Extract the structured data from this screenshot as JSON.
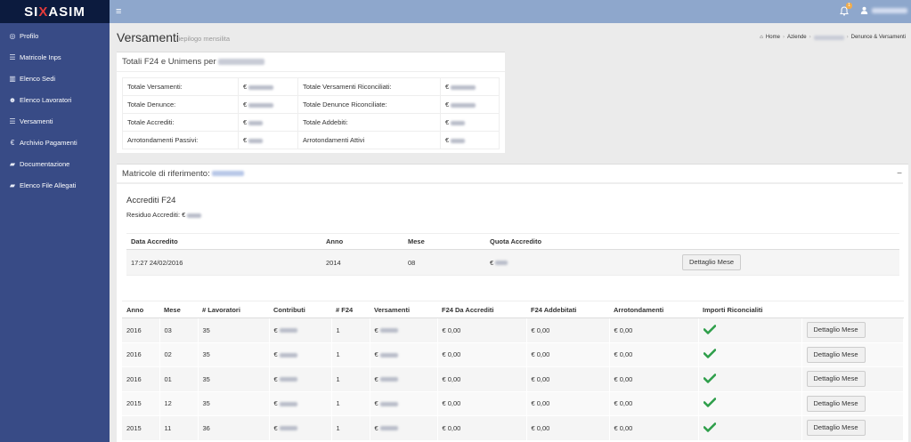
{
  "brand": {
    "logo_text_a": "SI",
    "logo_text_b": "X",
    "logo_text_c": "ASIM"
  },
  "sidebar": {
    "items": [
      {
        "label": "Profilo",
        "icon": "dashboard-icon"
      },
      {
        "label": "Matricole Inps",
        "icon": "list-icon"
      },
      {
        "label": "Elenco Sedi",
        "icon": "bank-icon"
      },
      {
        "label": "Elenco Lavoratori",
        "icon": "users-icon"
      },
      {
        "label": "Versamenti",
        "icon": "list-icon"
      },
      {
        "label": "Archivio Pagamenti",
        "icon": "euro-icon"
      },
      {
        "label": "Documentazione",
        "icon": "folder-icon"
      },
      {
        "label": "Elenco File Allegati",
        "icon": "folder-icon"
      }
    ]
  },
  "topbar": {
    "notifications_count": "1"
  },
  "header": {
    "title": "Versamenti",
    "subtitle": "riepilogo mensilita",
    "breadcrumb": {
      "home": "Home",
      "aziende": "Aziende",
      "current": "Denunce & Versamenti"
    }
  },
  "totals": {
    "title": "Totali F24 e Unimens per",
    "rows": [
      {
        "l1": "Totale Versamenti:",
        "v1": "€",
        "l2": "Totale Versamenti Riconciliati:",
        "v2": "€"
      },
      {
        "l1": "Totale Denunce:",
        "v1": "€",
        "l2": "Totale Denunce Riconciliate:",
        "v2": "€"
      },
      {
        "l1": "Totale Accrediti:",
        "v1": "€",
        "l2": "Totale Addebiti:",
        "v2": "€"
      },
      {
        "l1": "Arrotondamenti Passivi:",
        "v1": "€",
        "l2": "Arrotondamenti Attivi",
        "v2": "€"
      }
    ]
  },
  "matricola": {
    "title": "Matricole di riferimento:",
    "accrediti_title": "Accrediti F24",
    "residuo_label": "Residuo Accrediti: €",
    "accrediti_headers": [
      "Data Accredito",
      "Anno",
      "Mese",
      "Quota Accredito"
    ],
    "accrediti_rows": [
      {
        "data": "17:27 24/02/2016",
        "anno": "2014",
        "mese": "08",
        "quota": "€",
        "button": "Dettaglio Mese"
      }
    ],
    "months_headers": [
      "Anno",
      "Mese",
      "# Lavoratori",
      "Contributi",
      "# F24",
      "Versamenti",
      "F24 Da Accrediti",
      "F24 Addebitati",
      "Arrotondamenti",
      "Importi Riconcialiti"
    ],
    "months_rows": [
      {
        "anno": "2016",
        "mese": "03",
        "lav": "35",
        "contributi": "€",
        "f24": "1",
        "versamenti": "€",
        "da_accrediti": "€ 0,00",
        "addebitati": "€ 0,00",
        "arrotondamenti": "€ 0,00",
        "button": "Dettaglio Mese"
      },
      {
        "anno": "2016",
        "mese": "02",
        "lav": "35",
        "contributi": "€",
        "f24": "1",
        "versamenti": "€",
        "da_accrediti": "€ 0,00",
        "addebitati": "€ 0,00",
        "arrotondamenti": "€ 0,00",
        "button": "Dettaglio Mese"
      },
      {
        "anno": "2016",
        "mese": "01",
        "lav": "35",
        "contributi": "€",
        "f24": "1",
        "versamenti": "€",
        "da_accrediti": "€ 0,00",
        "addebitati": "€ 0,00",
        "arrotondamenti": "€ 0,00",
        "button": "Dettaglio Mese"
      },
      {
        "anno": "2015",
        "mese": "12",
        "lav": "35",
        "contributi": "€",
        "f24": "1",
        "versamenti": "€",
        "da_accrediti": "€ 0,00",
        "addebitati": "€ 0,00",
        "arrotondamenti": "€ 0,00",
        "button": "Dettaglio Mese"
      },
      {
        "anno": "2015",
        "mese": "11",
        "lav": "36",
        "contributi": "€",
        "f24": "1",
        "versamenti": "€",
        "da_accrediti": "€ 0,00",
        "addebitati": "€ 0,00",
        "arrotondamenti": "€ 0,00",
        "button": "Dettaglio Mese"
      }
    ]
  },
  "colors": {
    "sidebar": "#384b86",
    "topbar": "#8ea7cc",
    "logo_bg": "#0c1b3e",
    "check": "#2e9e4a"
  }
}
